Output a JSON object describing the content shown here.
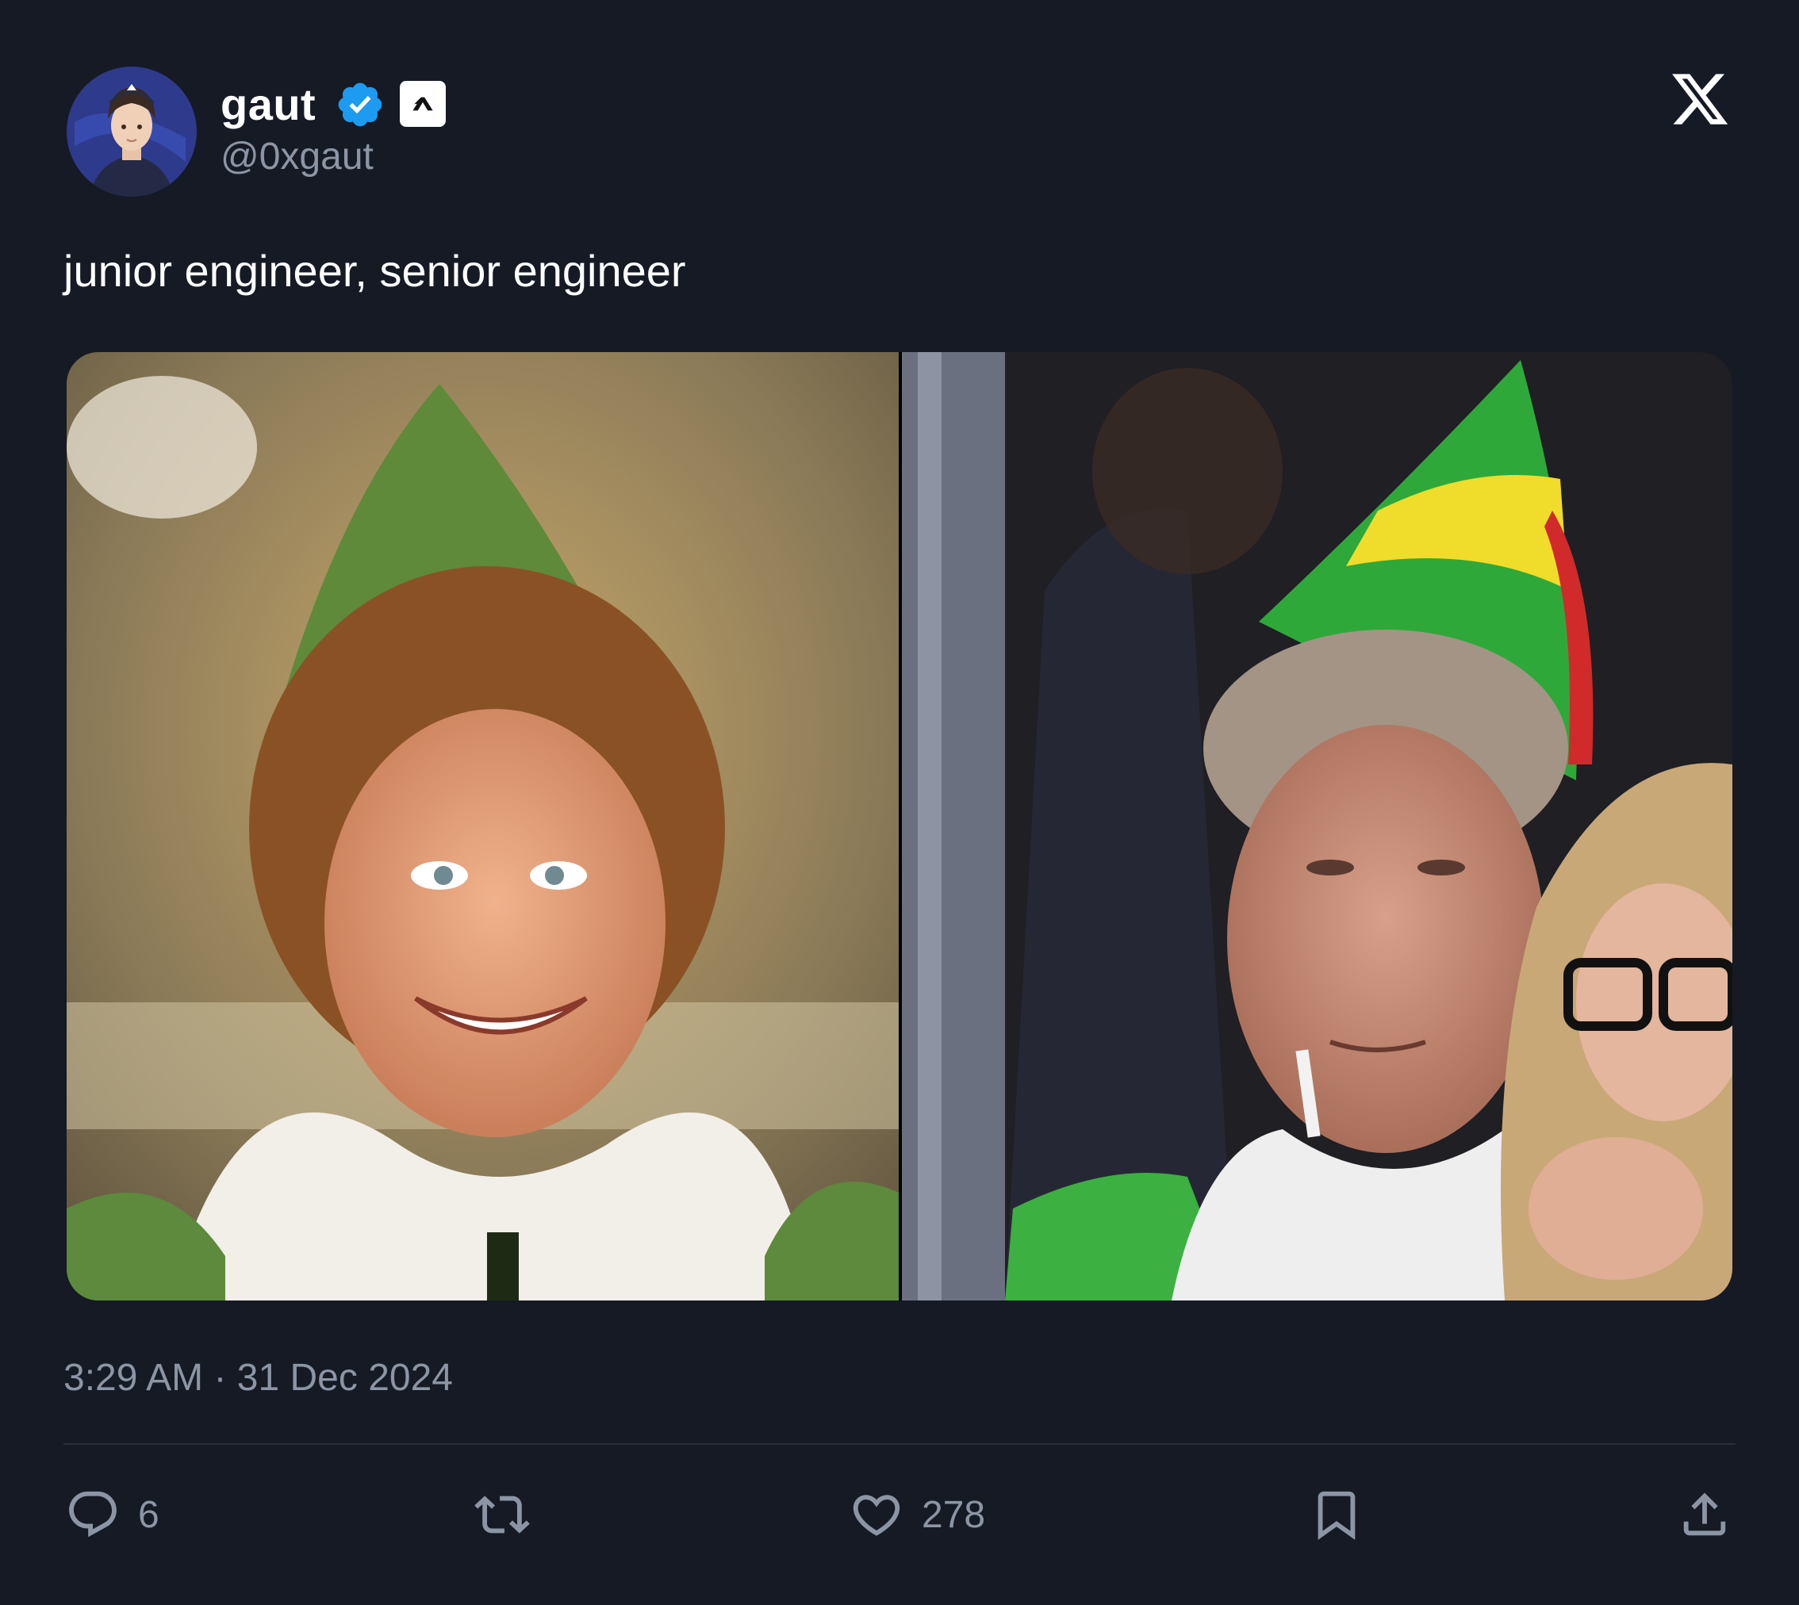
{
  "author": {
    "display_name": "gaut",
    "handle": "@0xgaut",
    "verified": true,
    "avatar_icon": "avatar-illustration"
  },
  "tweet": {
    "text": "junior engineer, senior engineer",
    "timestamp": "3:29 AM · 31 Dec 2024",
    "media": [
      {
        "name": "media-image-left"
      },
      {
        "name": "media-image-right"
      }
    ]
  },
  "actions": {
    "reply_count": "6",
    "like_count": "278"
  },
  "colors": {
    "background": "#161a25",
    "text_primary": "#ffffff",
    "text_secondary": "#8b95a5",
    "verified_blue": "#1d9bf0",
    "divider": "#2a2f3b"
  }
}
